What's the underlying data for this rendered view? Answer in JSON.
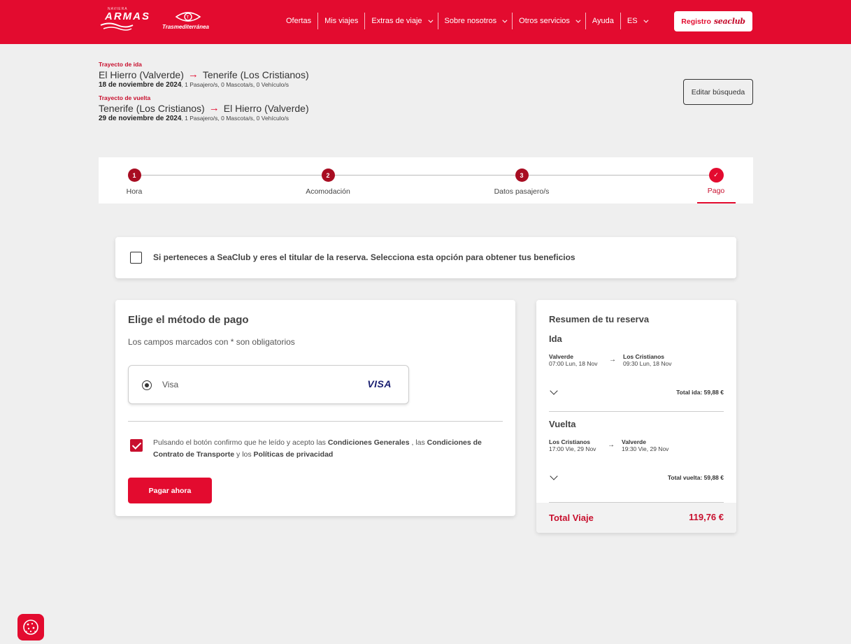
{
  "header": {
    "logo_armas_small": "NAVIERA",
    "logo_armas": "ARMAS",
    "logo_trasme": "Trasmediterránea",
    "nav": [
      {
        "label": "Ofertas",
        "dropdown": false
      },
      {
        "label": "Mis viajes",
        "dropdown": false
      },
      {
        "label": "Extras de viaje",
        "dropdown": true
      },
      {
        "label": "Sobre nosotros",
        "dropdown": true
      },
      {
        "label": "Otros servicios",
        "dropdown": true
      },
      {
        "label": "Ayuda",
        "dropdown": false
      },
      {
        "label": "ES",
        "dropdown": true
      }
    ],
    "register_label": "Registro",
    "register_brand": "seaclub"
  },
  "search": {
    "outbound": {
      "label": "Trayecto de ida",
      "from": "El Hierro (Valverde)",
      "to": "Tenerife (Los Cristianos)",
      "date": "18 de noviembre de 2024",
      "details": ", 1 Pasajero/s, 0 Mascota/s, 0 Vehículo/s"
    },
    "return": {
      "label": "Trayecto de vuelta",
      "from": "Tenerife (Los Cristianos)",
      "to": "El Hierro (Valverde)",
      "date": "29 de noviembre de 2024",
      "details": ", 1 Pasajero/s, 0 Mascota/s, 0 Vehículo/s"
    },
    "edit_label": "Editar búsqueda"
  },
  "stepper": {
    "steps": [
      {
        "num": "1",
        "label": "Hora"
      },
      {
        "num": "2",
        "label": "Acomodación"
      },
      {
        "num": "3",
        "label": "Datos pasajero/s"
      },
      {
        "num": "✓",
        "label": "Pago"
      }
    ],
    "active_index": 3
  },
  "seaclub": {
    "checked": false,
    "text": "Si perteneces a SeaClub y eres el titular de la reserva. Selecciona esta opción para obtener tus beneficios"
  },
  "payment": {
    "title": "Elige el método de pago",
    "required_note": "Los campos marcados con * son obligatorios",
    "method": {
      "label": "Visa",
      "logo": "VISA",
      "selected": true
    },
    "terms": {
      "checked": true,
      "prefix": "Pulsando el botón confirmo que he leído y acepto las ",
      "link1": "Condiciones Generales",
      "mid": " , las ",
      "link2": "Condiciones de Contrato de Transporte",
      "mid2": " y los ",
      "link3": "Políticas de privacidad"
    },
    "pay_button": "Pagar ahora"
  },
  "summary": {
    "title": "Resumen de tu reserva",
    "outbound": {
      "title": "Ida",
      "from_port": "Valverde",
      "from_time": "07:00 Lun, 18 Nov",
      "to_port": "Los Cristianos",
      "to_time": "09:30 Lun, 18 Nov",
      "subtotal": "Total ida: 59,88 €"
    },
    "return": {
      "title": "Vuelta",
      "from_port": "Los Cristianos",
      "from_time": "17:00 Vie, 29 Nov",
      "to_port": "Valverde",
      "to_time": "19:30 Vie, 29 Nov",
      "subtotal": "Total vuelta: 59,88 €"
    },
    "total_label": "Total Viaje",
    "total_value": "119,76 €"
  },
  "colors": {
    "brand_red": "#e30b2f",
    "dark_red": "#c8102e",
    "background": "#efefef"
  },
  "icons": {
    "cookie": "cookie-settings-icon"
  }
}
